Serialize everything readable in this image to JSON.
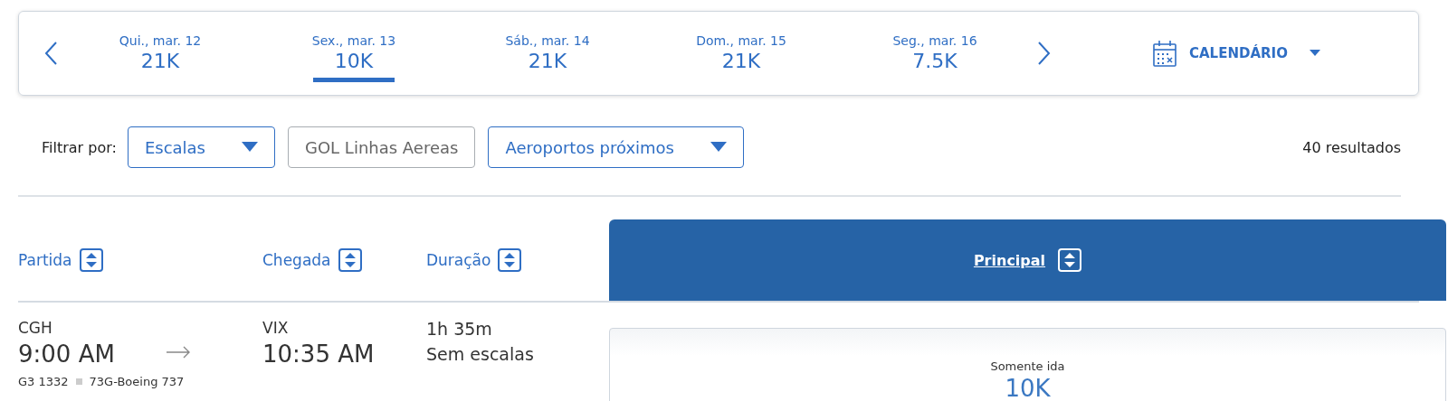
{
  "date_bar": {
    "dates": [
      {
        "label": "Qui., mar. 12",
        "price": "21K",
        "selected": false
      },
      {
        "label": "Sex., mar. 13",
        "price": "10K",
        "selected": true
      },
      {
        "label": "Sáb., mar. 14",
        "price": "21K",
        "selected": false
      },
      {
        "label": "Dom., mar. 15",
        "price": "21K",
        "selected": false
      },
      {
        "label": "Seg., mar. 16",
        "price": "7.5K",
        "selected": false
      }
    ],
    "calendar": {
      "label": "CALENDÁRIO"
    }
  },
  "filters": {
    "label": "Filtrar por:",
    "items": [
      {
        "label": "Escalas",
        "kind": "dropdown"
      },
      {
        "label": "GOL Linhas Aereas",
        "kind": "toggle"
      },
      {
        "label": "Aeroportos próximos",
        "kind": "dropdown"
      }
    ],
    "results": "40 resultados"
  },
  "columns": [
    {
      "label": "Partida"
    },
    {
      "label": "Chegada"
    },
    {
      "label": "Duração"
    }
  ],
  "fare_header": {
    "label": "Principal"
  },
  "flights": [
    {
      "origin": "CGH",
      "depart_time": "9:00 AM",
      "destination": "VIX",
      "arrive_time": "10:35 AM",
      "duration": "1h 35m",
      "stops": "Sem escalas",
      "flight_number": "G3 1332",
      "aircraft": "73G-Boeing 737",
      "fare": {
        "label": "Somente ida",
        "price": "10K"
      }
    }
  ]
}
